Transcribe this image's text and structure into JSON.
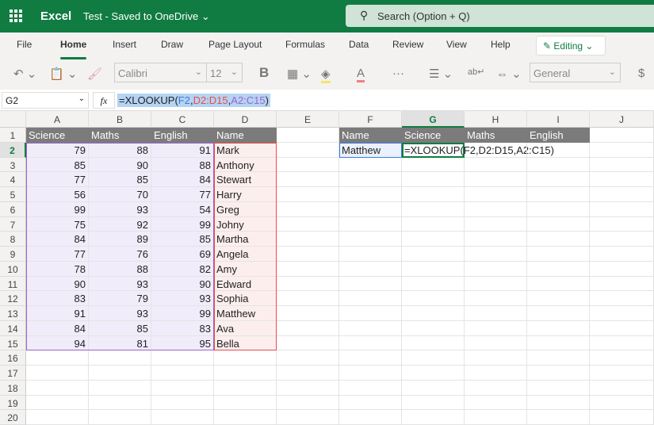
{
  "app": {
    "name": "Excel",
    "doc_title": "Test",
    "doc_status": "Saved to OneDrive",
    "search_placeholder": "Search (Option + Q)"
  },
  "tabs": [
    "File",
    "Home",
    "Insert",
    "Draw",
    "Page Layout",
    "Formulas",
    "Data",
    "Review",
    "View",
    "Help"
  ],
  "active_tab": "Home",
  "editing_label": "Editing",
  "toolbar": {
    "font": "Calibri",
    "size": "12",
    "bold": "B",
    "number_format": "General",
    "currency": "$"
  },
  "formula_bar": {
    "name_box": "G2",
    "fx": "fx",
    "formula": "=XLOOKUP(F2,D2:D15,A2:C15)"
  },
  "columns": [
    "A",
    "B",
    "C",
    "D",
    "E",
    "F",
    "G",
    "H",
    "I",
    "J"
  ],
  "selected_column": "G",
  "rows": [
    "1",
    "2",
    "3",
    "4",
    "5",
    "6",
    "7",
    "8",
    "9",
    "10",
    "11",
    "12",
    "13",
    "14",
    "15",
    "16",
    "17",
    "18",
    "19",
    "20"
  ],
  "selected_row": "2",
  "table": {
    "headers": [
      "Science",
      "Maths",
      "English",
      "Name"
    ],
    "data": [
      [
        "79",
        "88",
        "91",
        "Mark"
      ],
      [
        "85",
        "90",
        "88",
        "Anthony"
      ],
      [
        "77",
        "85",
        "84",
        "Stewart"
      ],
      [
        "56",
        "70",
        "77",
        "Harry"
      ],
      [
        "99",
        "93",
        "54",
        "Greg"
      ],
      [
        "75",
        "92",
        "99",
        "Johny"
      ],
      [
        "84",
        "89",
        "85",
        "Martha"
      ],
      [
        "77",
        "76",
        "69",
        "Angela"
      ],
      [
        "78",
        "88",
        "82",
        "Amy"
      ],
      [
        "90",
        "93",
        "90",
        "Edward"
      ],
      [
        "83",
        "79",
        "93",
        "Sophia"
      ],
      [
        "91",
        "93",
        "99",
        "Matthew"
      ],
      [
        "84",
        "85",
        "83",
        "Ava"
      ],
      [
        "94",
        "81",
        "95",
        "Bella"
      ]
    ]
  },
  "lookup": {
    "headers": [
      "Name",
      "Science",
      "Maths",
      "English"
    ],
    "name": "Matthew",
    "formula": "=XLOOKUP(F2,D2:D15,A2:C15)"
  },
  "colors": {
    "brand": "#107c41",
    "header_fill": "#7b7b7b",
    "range_purple": "#9966cc",
    "range_red": "#e84c4c",
    "range_blue": "#3b7ddd"
  }
}
